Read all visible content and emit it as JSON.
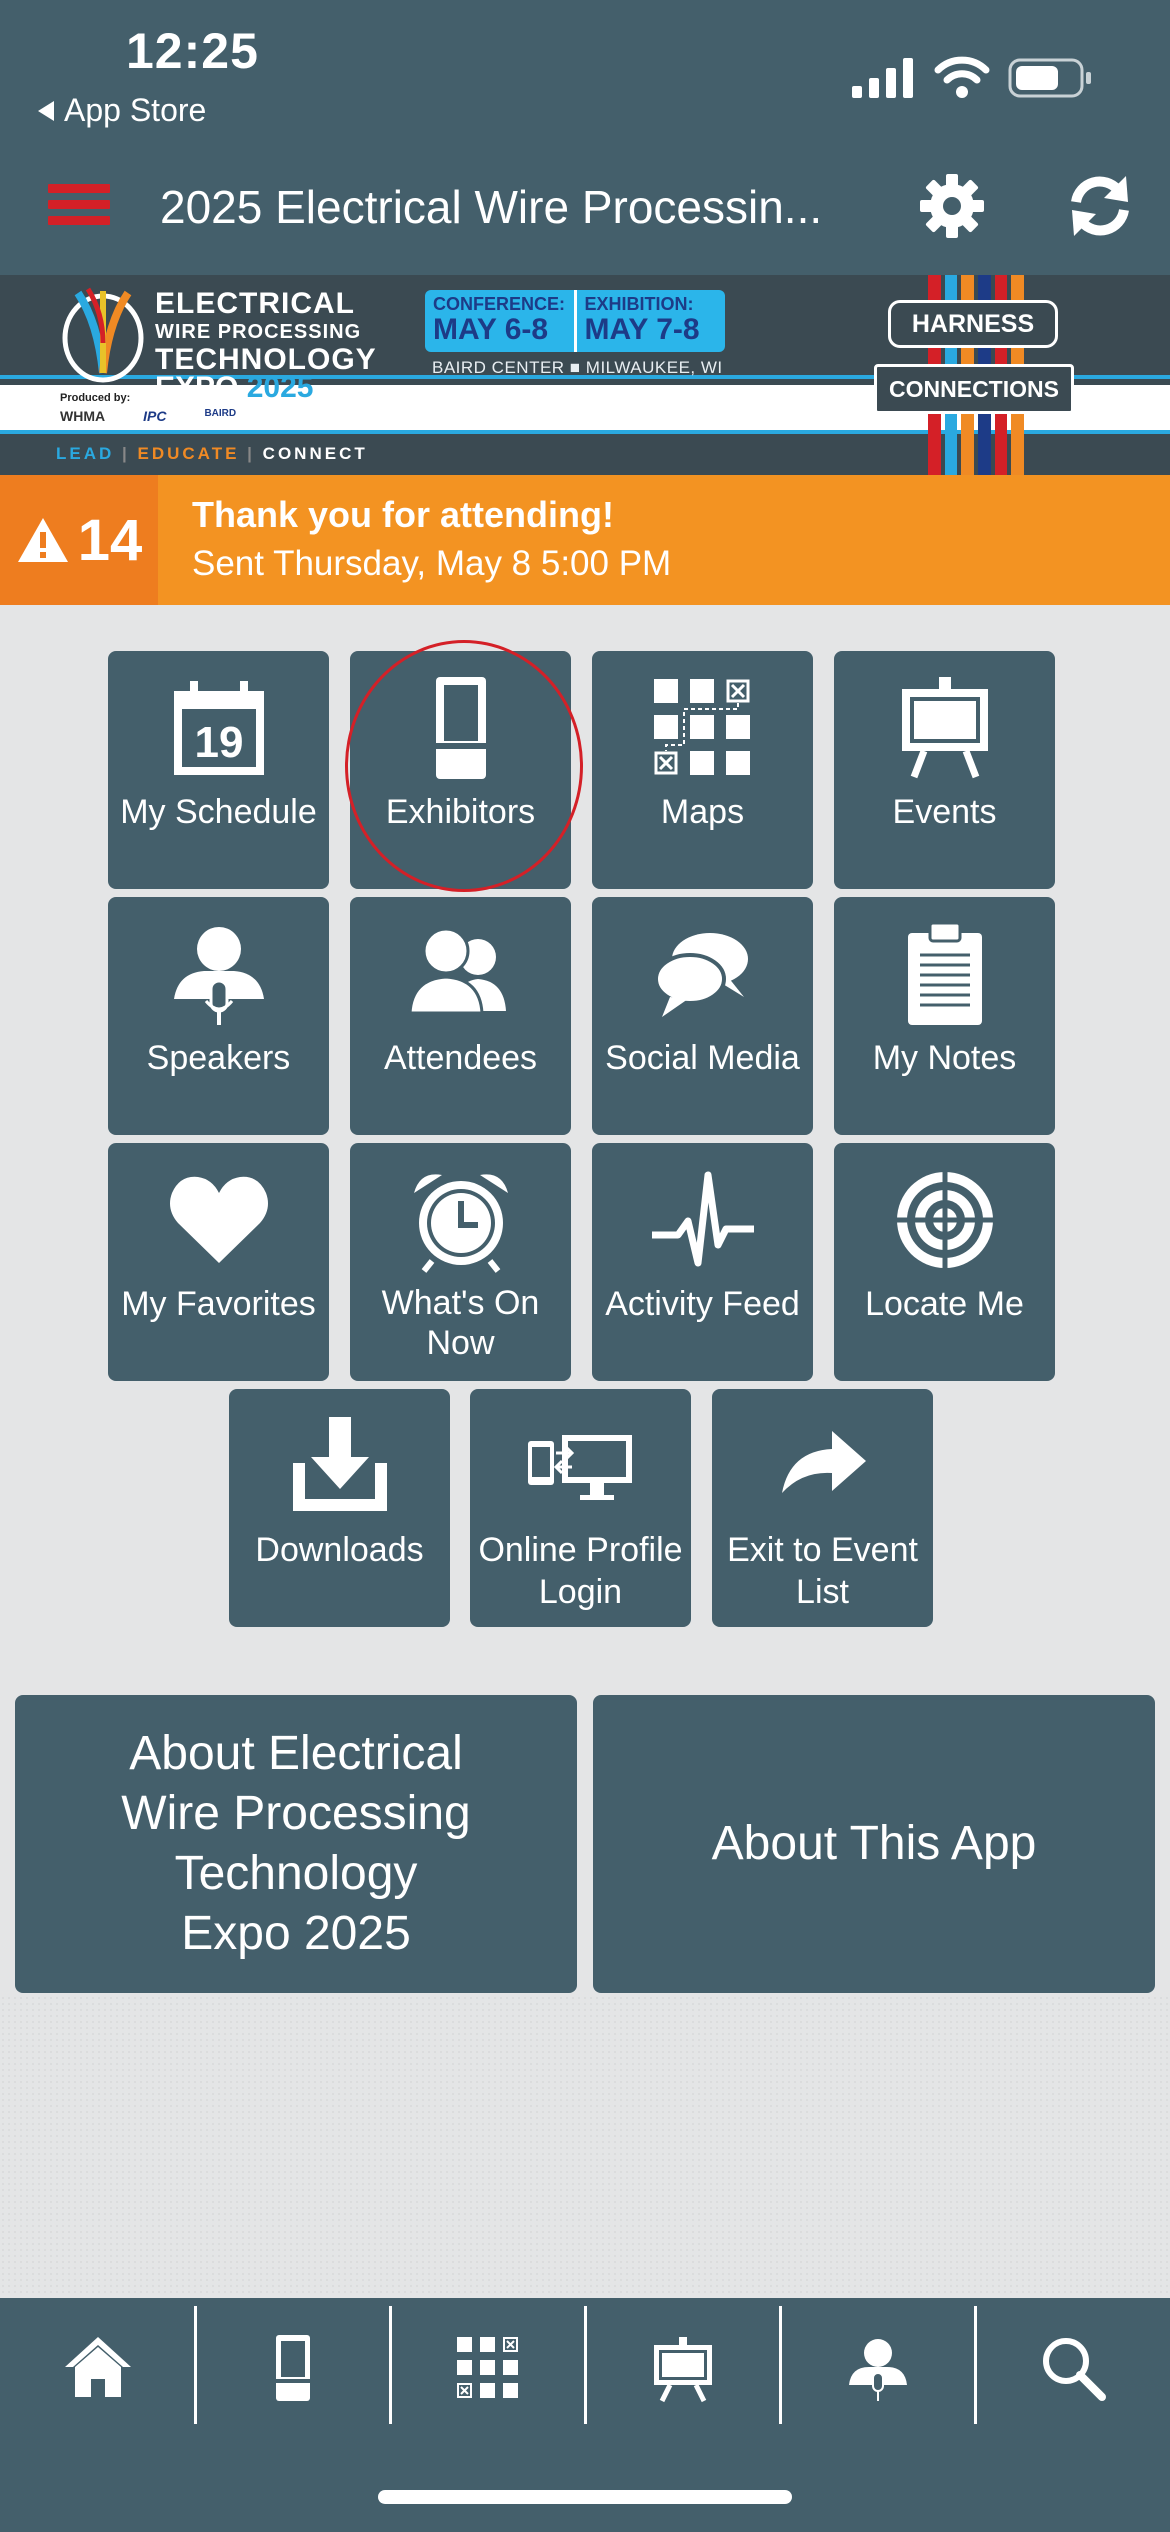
{
  "status_bar": {
    "time": "12:25",
    "back_label": "App Store"
  },
  "navbar": {
    "title": "2025 Electrical Wire Processin..."
  },
  "banner": {
    "logo_line1": "ELECTRICAL",
    "logo_line2": "WIRE PROCESSING",
    "logo_line3": "TECHNOLOGY",
    "logo_line4_a": "EXPO",
    "logo_line4_b": "2025",
    "conference_label": "CONFERENCE:",
    "conference_dates": "MAY 6-8",
    "exhibition_label": "EXHIBITION:",
    "exhibition_dates": "MAY 7-8",
    "venue": "BAIRD CENTER ■ MILWAUKEE, WI",
    "produced_by": "Produced by:",
    "sponsors": [
      "WHMA",
      "IPC",
      "BAIRD"
    ],
    "motto": [
      "LEAD",
      "EDUCATE",
      "CONNECT"
    ],
    "harness_top": "HARNESS",
    "harness_bottom": "CONNECTIONS"
  },
  "alert": {
    "count": "14",
    "title": "Thank you for attending!",
    "subtitle": "Sent Thursday, May 8 5:00 PM"
  },
  "tiles": [
    {
      "label": "My Schedule",
      "icon": "calendar-icon",
      "calendar_day": "19"
    },
    {
      "label": "Exhibitors",
      "icon": "booth-icon"
    },
    {
      "label": "Maps",
      "icon": "map-grid-icon"
    },
    {
      "label": "Events",
      "icon": "easel-icon"
    },
    {
      "label": "Speakers",
      "icon": "speaker-icon"
    },
    {
      "label": "Attendees",
      "icon": "attendees-icon"
    },
    {
      "label": "Social Media",
      "icon": "chat-bubbles-icon"
    },
    {
      "label": "My Notes",
      "icon": "clipboard-icon"
    },
    {
      "label": "My Favorites",
      "icon": "heart-icon"
    },
    {
      "label": "What's On Now",
      "icon": "alarm-clock-icon"
    },
    {
      "label": "Activity Feed",
      "icon": "pulse-icon"
    },
    {
      "label": "Locate Me",
      "icon": "crosshair-icon"
    },
    {
      "label": "Downloads",
      "icon": "download-icon"
    },
    {
      "label": "Online Profile Login",
      "icon": "devices-icon"
    },
    {
      "label": "Exit to Event List",
      "icon": "share-arrow-icon"
    }
  ],
  "about": {
    "event": "About Electrical\nWire Processing\nTechnology\nExpo 2025",
    "app": "About This App"
  },
  "tabbar": [
    "home-icon",
    "booth-icon",
    "map-grid-icon",
    "easel-icon",
    "speaker-icon",
    "search-icon"
  ],
  "colors": {
    "primary": "#445f6b",
    "accent_red": "#d42027",
    "alert_orange": "#f39322"
  }
}
